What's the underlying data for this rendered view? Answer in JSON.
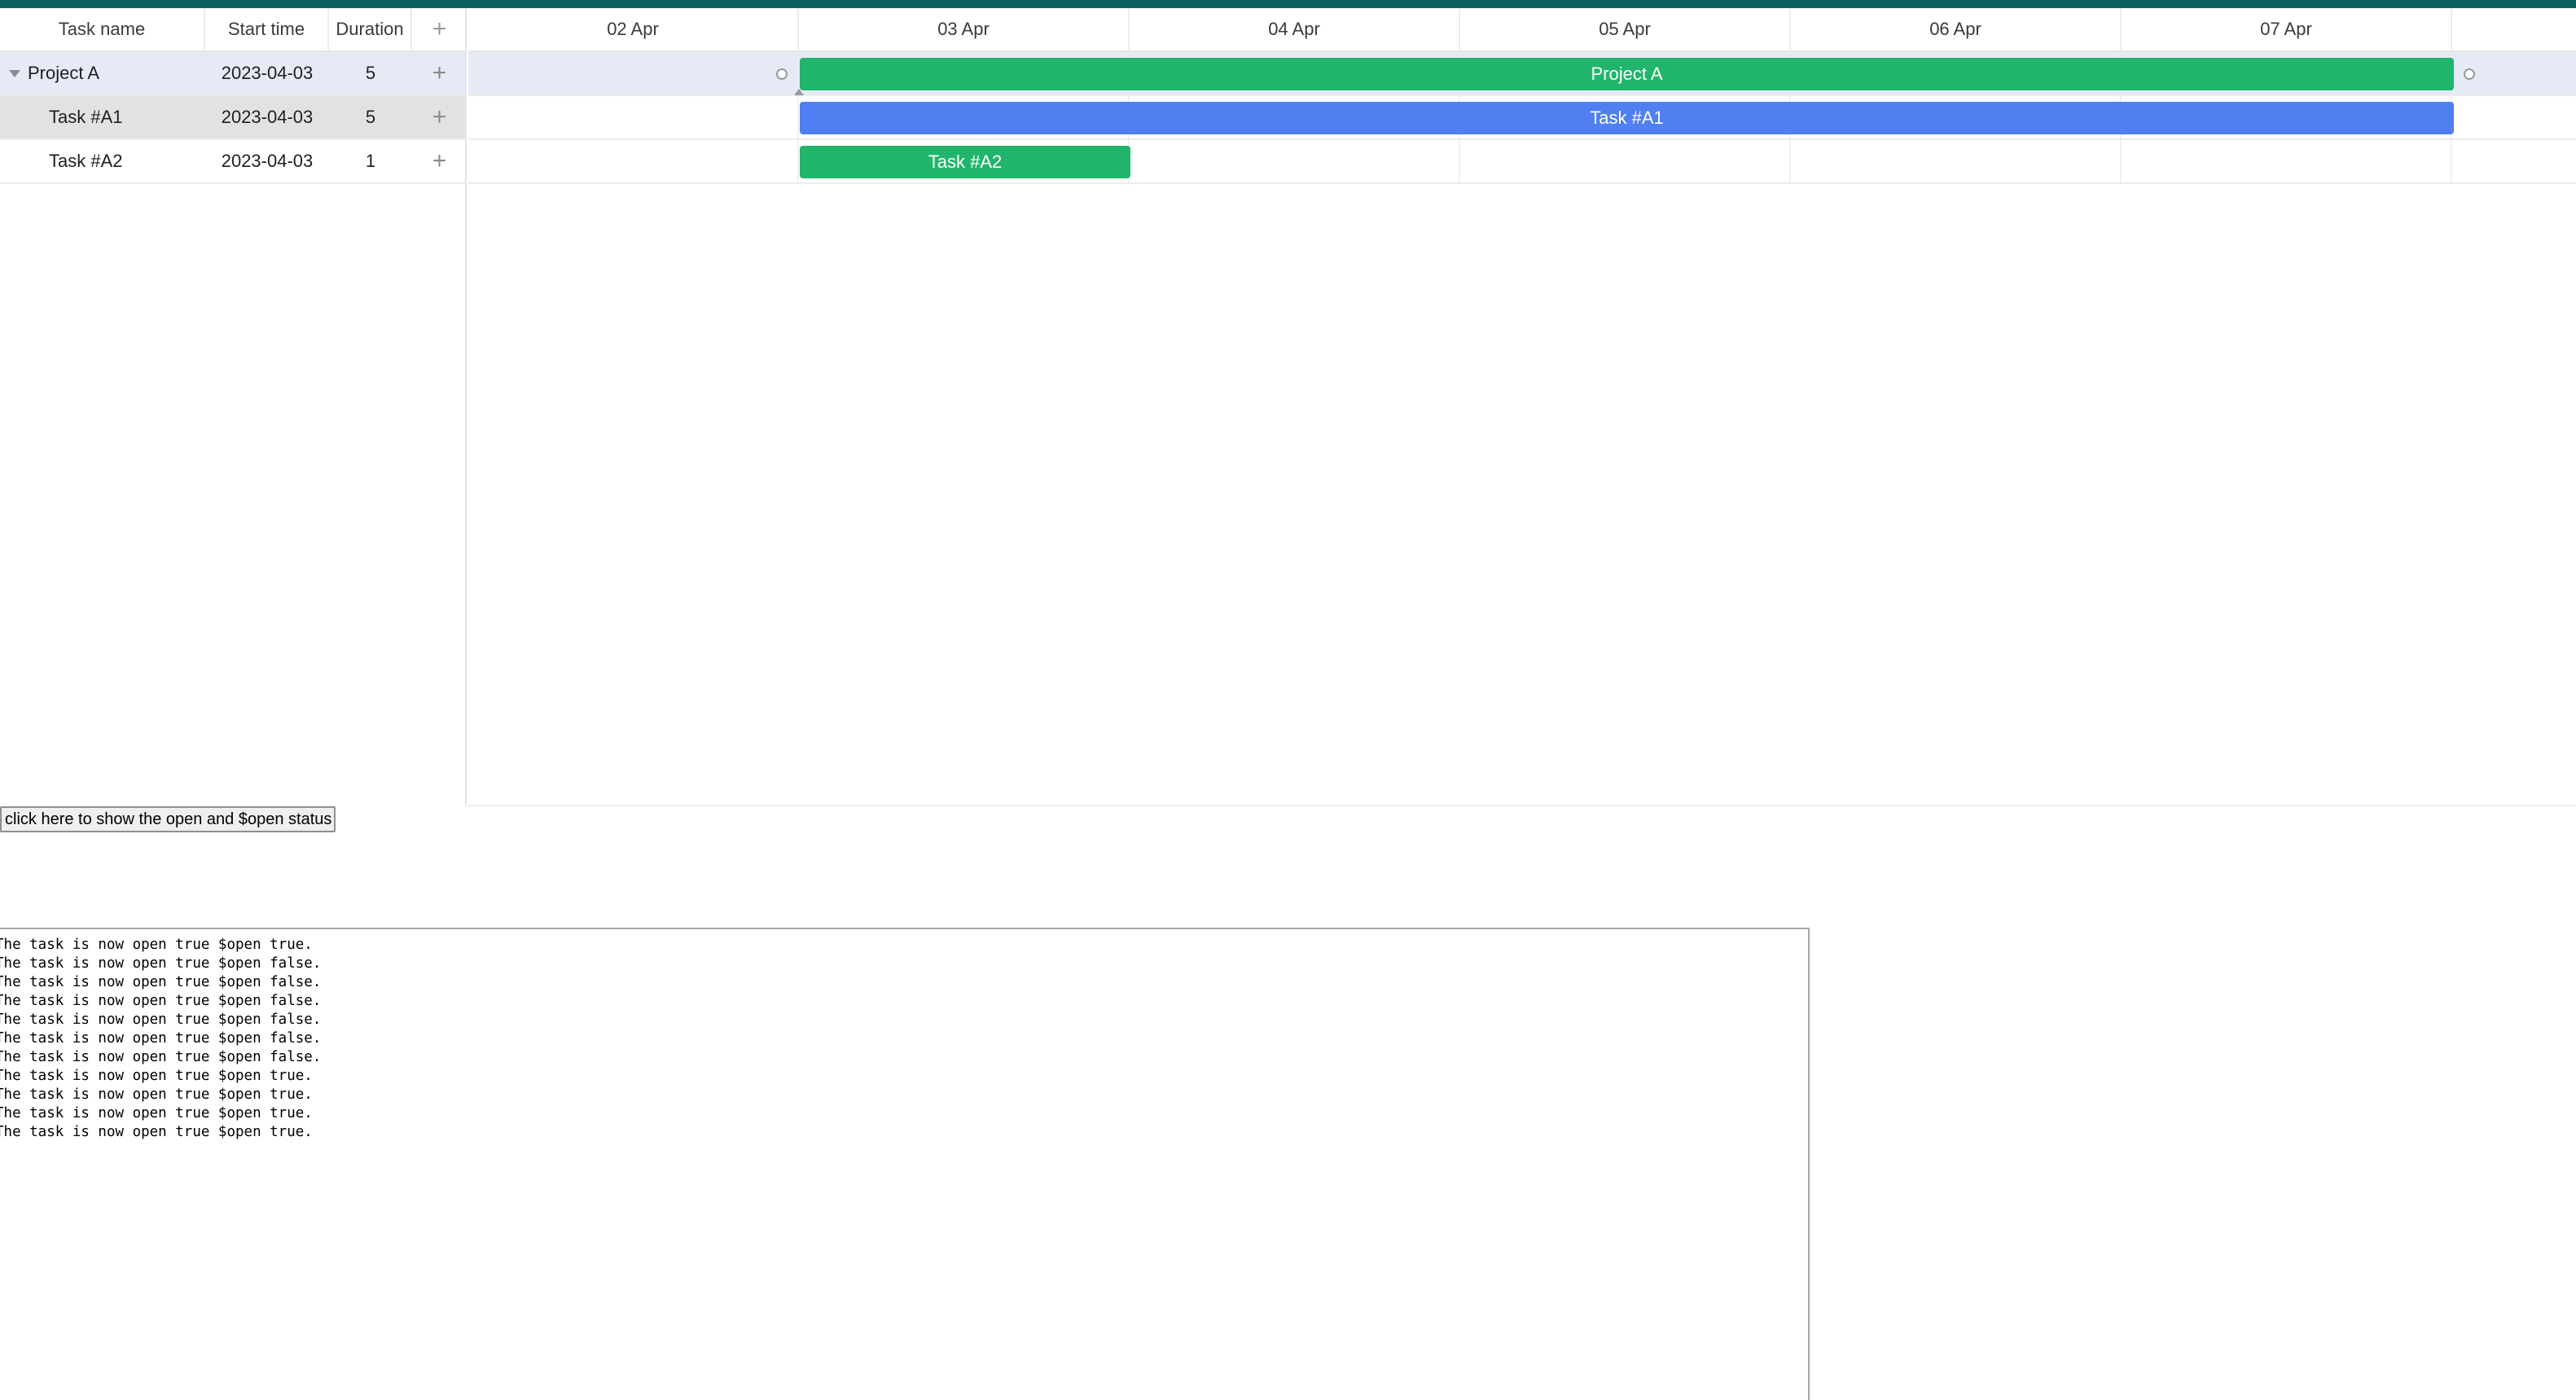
{
  "grid": {
    "columns": [
      {
        "key": "text",
        "label": "Task name"
      },
      {
        "key": "start_date",
        "label": "Start time"
      },
      {
        "key": "duration",
        "label": "Duration"
      },
      {
        "key": "add",
        "label": "+"
      }
    ],
    "rows": [
      {
        "name": "Project A",
        "start": "2023-04-03",
        "duration": "5",
        "add": "+",
        "type": "project",
        "open": true
      },
      {
        "name": "Task #A1",
        "start": "2023-04-03",
        "duration": "5",
        "add": "+",
        "type": "task",
        "selected": true
      },
      {
        "name": "Task #A2",
        "start": "2023-04-03",
        "duration": "1",
        "add": "+",
        "type": "task"
      }
    ]
  },
  "timeline": {
    "scale": [
      "02 Apr",
      "03 Apr",
      "04 Apr",
      "05 Apr",
      "06 Apr",
      "07 Apr"
    ],
    "bars": [
      {
        "label": "Project A",
        "start_day": "03 Apr",
        "duration_days": 5,
        "color": "#20b56b"
      },
      {
        "label": "Task #A1",
        "start_day": "03 Apr",
        "duration_days": 5,
        "color": "#4f7ff0"
      },
      {
        "label": "Task #A2",
        "start_day": "03 Apr",
        "duration_days": 1,
        "color": "#20b56b"
      }
    ]
  },
  "button": {
    "label": "click here to show the open and $open status"
  },
  "log": {
    "lines": [
      "The task is now open true $open true.",
      "The task is now open true $open false.",
      "The task is now open true $open false.",
      "The task is now open true $open false.",
      "The task is now open true $open false.",
      "The task is now open true $open false.",
      "The task is now open true $open false.",
      "The task is now open true $open true.",
      "The task is now open true $open true.",
      "The task is now open true $open true.",
      "The task is now open true $open true."
    ]
  },
  "colors": {
    "header_bar": "#0b5e5e",
    "project_bar": "#20b56b",
    "task_bar": "#4f7ff0",
    "project_row_bg": "#e6eaf6",
    "selected_row_bg": "#e2e2e2"
  }
}
